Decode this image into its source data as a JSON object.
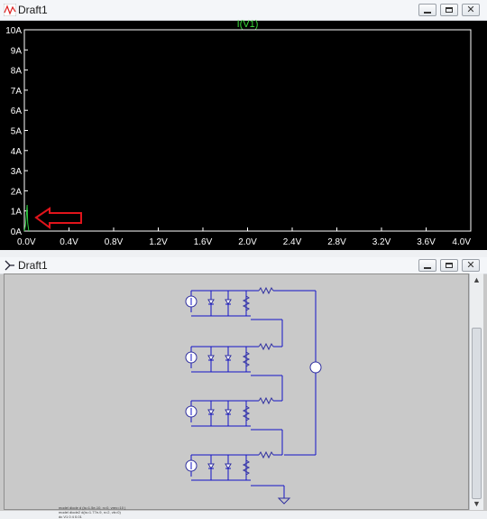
{
  "plot_window": {
    "title": "Draft1",
    "buttons": {
      "minimize": "—",
      "maximize": "▢",
      "close": "✕"
    }
  },
  "chart_data": {
    "type": "line",
    "title": "I(V1)",
    "xlabel": "",
    "ylabel": "",
    "x_ticks": [
      "0.0V",
      "0.4V",
      "0.8V",
      "1.2V",
      "1.6V",
      "2.0V",
      "2.4V",
      "2.8V",
      "3.2V",
      "3.6V",
      "4.0V"
    ],
    "y_ticks": [
      "0A",
      "1A",
      "2A",
      "3A",
      "4A",
      "5A",
      "6A",
      "7A",
      "8A",
      "9A",
      "10A"
    ],
    "xlim": [
      0,
      4
    ],
    "ylim": [
      0,
      10
    ],
    "series": [
      {
        "name": "I(V1)",
        "x": [
          0.0,
          0.01,
          0.02,
          0.025,
          0.03,
          0.04
        ],
        "y": [
          0.0,
          0.3,
          0.9,
          1.3,
          0.4,
          0.0
        ]
      }
    ],
    "grid": false,
    "legend": "top-center",
    "colors": {
      "trace": "#2ecc40",
      "axis": "#ffffff",
      "title": "#3adb3a",
      "annotation_arrow": "#e0141b"
    }
  },
  "schematic_window": {
    "title": "Draft1",
    "buttons": {
      "minimize": "—",
      "maximize": "▢",
      "close": "✕"
    },
    "netlist": [
      "model diode d (is=1.5e-10, n=0, vrev=10 )",
      "model diode2 d(is=1.77e-9, n=2, vb=0)",
      "dc V1 0 4 0.01"
    ],
    "colors": {
      "wire": "#1414c8",
      "component": "#3030a0",
      "background": "#c9c9c9"
    }
  }
}
